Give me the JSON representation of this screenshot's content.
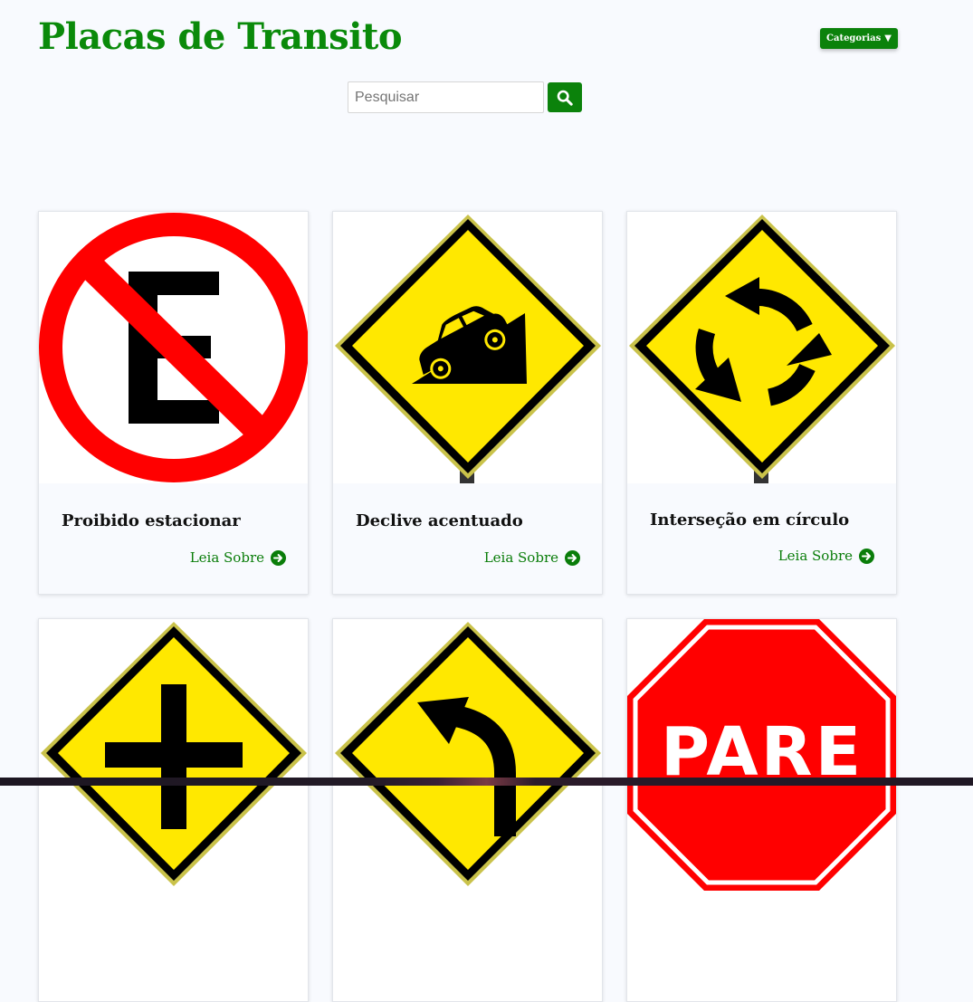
{
  "header": {
    "site_title": "Placas de Transito",
    "categories_label": "Categorias",
    "categories_arrow": "▼"
  },
  "search": {
    "placeholder": "Pesquisar",
    "value": "",
    "button_icon": "search-icon"
  },
  "colors": {
    "brand_green": "#0b820b",
    "sign_red": "#ff0000",
    "sign_yellow": "#ffe600"
  },
  "cards": [
    {
      "title": "Proibido estacionar",
      "link_label": "Leia Sobre",
      "icon": "no-parking-sign-icon"
    },
    {
      "title": "Declive acentuado",
      "link_label": "Leia Sobre",
      "icon": "steep-descent-sign-icon"
    },
    {
      "title": "Interseção em círculo",
      "link_label": "Leia Sobre",
      "icon": "roundabout-sign-icon"
    },
    {
      "title": "",
      "link_label": "",
      "icon": "crossroad-sign-icon"
    },
    {
      "title": "",
      "link_label": "",
      "icon": "curve-left-sign-icon"
    },
    {
      "title": "",
      "link_label": "",
      "icon": "stop-sign-icon",
      "sign_text": "PARE"
    }
  ]
}
